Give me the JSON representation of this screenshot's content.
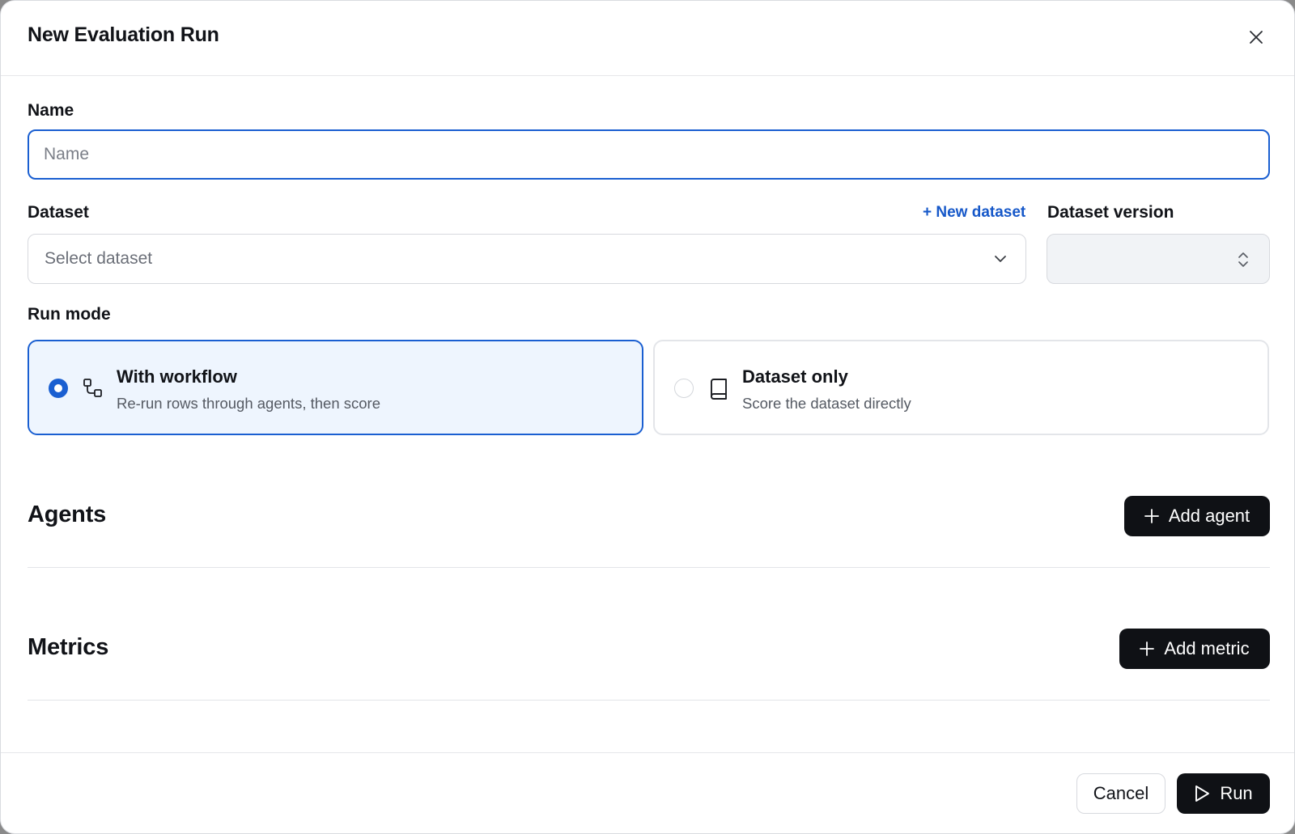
{
  "dialog": {
    "title": "New Evaluation Run",
    "close_icon": "close-icon"
  },
  "name_field": {
    "label": "Name",
    "placeholder": "Name",
    "value": ""
  },
  "dataset": {
    "label": "Dataset",
    "new_link": "+ New dataset",
    "placeholder": "Select dataset",
    "version_label": "Dataset version",
    "version_value": ""
  },
  "run_mode": {
    "label": "Run mode",
    "selected": "with_workflow",
    "options": [
      {
        "title": "With workflow",
        "description": "Re-run rows through agents, then score",
        "icon": "workflow-icon"
      },
      {
        "title": "Dataset only",
        "description": "Score the dataset directly",
        "icon": "book-icon"
      }
    ]
  },
  "agents": {
    "title": "Agents",
    "add_label": "Add agent"
  },
  "metrics": {
    "title": "Metrics",
    "add_label": "Add metric"
  },
  "footer": {
    "cancel_label": "Cancel",
    "run_label": "Run"
  },
  "colors": {
    "accent": "#1a5fd1",
    "link": "#1658c9",
    "dark_button": "#0f1115",
    "selected_card_bg": "#eef5fe"
  }
}
